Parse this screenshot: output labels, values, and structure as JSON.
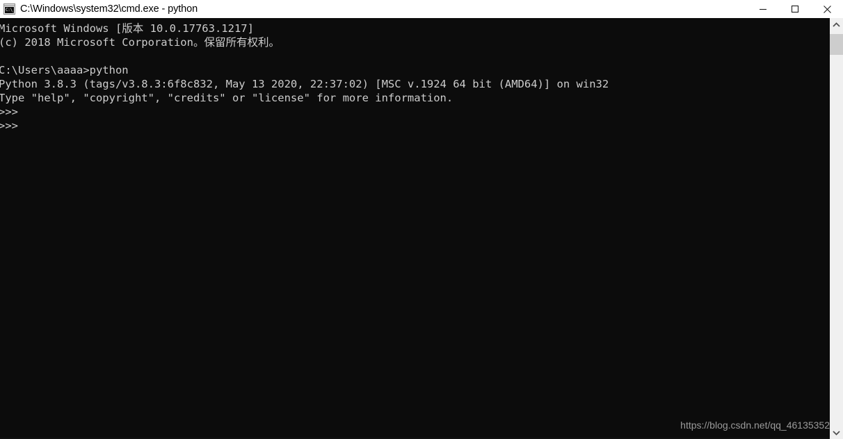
{
  "window": {
    "title": "C:\\Windows\\system32\\cmd.exe - python",
    "icon": "cmd-icon",
    "icon_glyph": "C:\\_",
    "background_color": "#0c0c0c",
    "text_color": "#cccccc",
    "titlebar_color": "#ffffff"
  },
  "window_controls": {
    "minimize": "minimize-button",
    "maximize": "maximize-button",
    "close": "close-button"
  },
  "console": {
    "lines": [
      "Microsoft Windows [版本 10.0.17763.1217]",
      "(c) 2018 Microsoft Corporation。保留所有权利。",
      "",
      "C:\\Users\\aaaa>python",
      "Python 3.8.3 (tags/v3.8.3:6f8c832, May 13 2020, 22:37:02) [MSC v.1924 64 bit (AMD64)] on win32",
      "Type \"help\", \"copyright\", \"credits\" or \"license\" for more information.",
      ">>>",
      ">>>"
    ],
    "text": "Microsoft Windows [版本 10.0.17763.1217]\n(c) 2018 Microsoft Corporation。保留所有权利。\n\nC:\\Users\\aaaa>python\nPython 3.8.3 (tags/v3.8.3:6f8c832, May 13 2020, 22:37:02) [MSC v.1924 64 bit (AMD64)] on win32\nType \"help\", \"copyright\", \"credits\" or \"license\" for more information.\n>>>\n>>>",
    "prompt": ">>>",
    "watermark": "https://blog.csdn.net/qq_46135352"
  },
  "scrollbar": {
    "up_arrow": "chevron-up-icon",
    "down_arrow": "chevron-down-icon",
    "thumb_color": "#cdcdcd",
    "track_color": "#f0f0f0"
  }
}
